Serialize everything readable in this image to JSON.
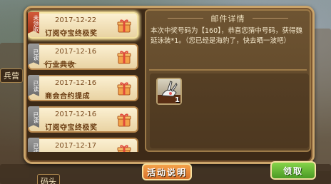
{
  "background_signs": [
    "兵营",
    "码头"
  ],
  "mail_list": [
    {
      "badge": "未领取",
      "date": "2017-12-22",
      "title": "订阅夺宝终极奖",
      "status": "unread",
      "struck": false
    },
    {
      "badge": "已读",
      "date": "2017-12-16",
      "title": "行业典收",
      "status": "read",
      "struck": true
    },
    {
      "badge": "已读",
      "date": "2017-12-16",
      "title": "商会合约提成",
      "status": "read",
      "struck": false
    },
    {
      "badge": "已读",
      "date": "2017-12-16",
      "title": "订阅夺宝终极奖",
      "status": "read",
      "struck": false
    },
    {
      "badge": "已读",
      "date": "2017-12-17",
      "title": "",
      "status": "read",
      "struck": false
    }
  ],
  "detail": {
    "title": "邮件详情",
    "body": "本次中奖号码为【160】，恭喜您猜中号码，获得魏延泳装*1。（您已经是海豹了，快去晒一波吧）"
  },
  "reward": {
    "item_icon": "rabbit-ears-swimsuit-icon",
    "quantity": "1"
  },
  "buttons": {
    "activity": "活动说明",
    "claim": "领取"
  },
  "colors": {
    "claim_button": "#5aab2e",
    "activity_button": "#e8893a",
    "frame_border": "#caa46a"
  }
}
